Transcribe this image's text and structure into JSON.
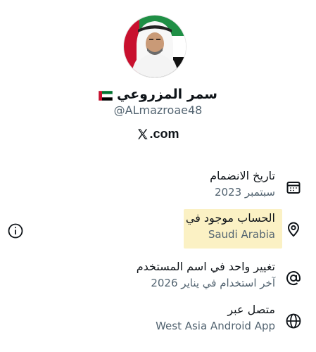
{
  "profile": {
    "name": "سمر المزروعي",
    "flag_icon": "uae-flag-icon",
    "handle": "@ALmazroae48",
    "domain_logo": "x-logo-icon",
    "domain_text": ".com"
  },
  "about": {
    "rows": [
      {
        "icon": "calendar-icon",
        "title": "تاريخ الانضمام",
        "sub": "سبتمبر 2023"
      },
      {
        "icon": "location-pin-icon",
        "title": "الحساب موجود في",
        "sub": "Saudi Arabia",
        "highlighted": true
      },
      {
        "icon": "at-sign-icon",
        "title": "تغيير واحد في اسم المستخدم",
        "sub": "آخر استخدام في يناير 2026"
      },
      {
        "icon": "globe-icon",
        "title": "متصل عبر",
        "sub": "West Asia Android App"
      }
    ],
    "info_icon": "info-icon"
  },
  "colors": {
    "text_primary": "#0f1419",
    "text_secondary": "#536471",
    "highlight": "#fbf1c4"
  }
}
